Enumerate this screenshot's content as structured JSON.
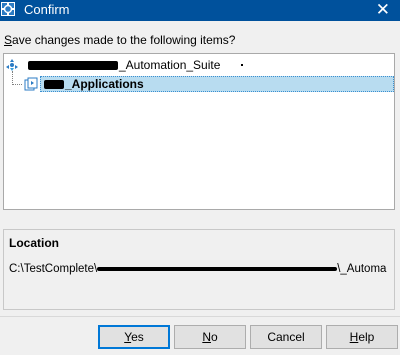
{
  "window": {
    "title": "Confirm",
    "close_glyph": "✕",
    "icon": "app-icon"
  },
  "prompt": {
    "text_before": "",
    "mnemonic": "S",
    "text_after": "ave changes made to the following items?"
  },
  "tree": {
    "items": [
      {
        "label": "_Automation_Suite",
        "icon": "project-suite-icon",
        "redacted": true,
        "selected": false
      },
      {
        "label": "_Applications",
        "icon": "project-icon",
        "redacted": true,
        "selected": true
      }
    ]
  },
  "location": {
    "heading": "Location",
    "path_visible": "C:\\TestComplete\\",
    "path_tail": "\\_Automa"
  },
  "buttons": [
    {
      "label": "Yes",
      "mnemonic": "Y",
      "rest": "es",
      "default": true
    },
    {
      "label": "No",
      "mnemonic": "N",
      "rest": "o",
      "default": false
    },
    {
      "label": "Cancel",
      "default": false
    },
    {
      "label": "Help",
      "mnemonic": "H",
      "rest": "elp",
      "default": false
    }
  ],
  "colors": {
    "titlebar": "#00519c",
    "selection": "#b8dcf0",
    "default_button_border": "#0078d7"
  }
}
